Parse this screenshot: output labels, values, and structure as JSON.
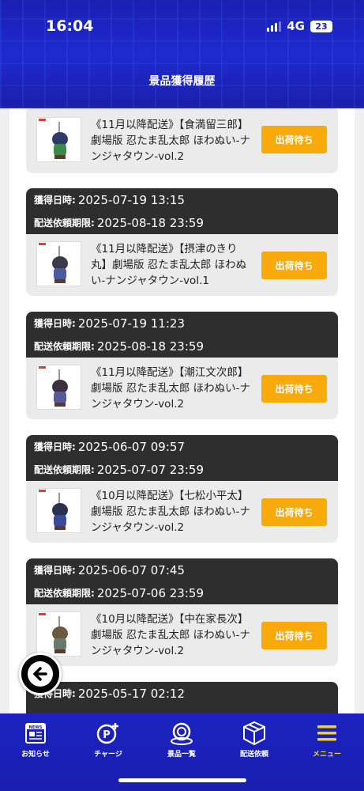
{
  "status_bar": {
    "time": "16:04",
    "network": "4G",
    "battery": "23"
  },
  "header": {
    "title": "景品獲得履歴"
  },
  "labels": {
    "acquired": "獲得日時:",
    "deadline": "配送依頼期限:"
  },
  "cards": [
    {
      "acquired": "",
      "deadline": "",
      "item": "《11月以降配送》【食満留三郎】劇場版 忍たま乱太郎 ほわぬい-ナンジャタウン-vol.2",
      "button": "出荷待ち",
      "colors": {
        "head": "#2d3a6a",
        "body": "#3a8a4a"
      }
    },
    {
      "acquired": "2025-07-19 13:15",
      "deadline": "2025-08-18 23:59",
      "item": "《11月以降配送》【摂津のきり丸】劇場版 忍たま乱太郎 ほわぬい-ナンジャタウン-vol.1",
      "button": "出荷待ち",
      "colors": {
        "head": "#3a3a4a",
        "body": "#4a5aa0"
      }
    },
    {
      "acquired": "2025-07-19 11:23",
      "deadline": "2025-08-18 23:59",
      "item": "《11月以降配送》【潮江文次郎】劇場版 忍たま乱太郎 ほわぬい-ナンジャタウン-vol.2",
      "button": "出荷待ち",
      "colors": {
        "head": "#3a3040",
        "body": "#5a5a9a"
      }
    },
    {
      "acquired": "2025-06-07 09:57",
      "deadline": "2025-07-07 23:59",
      "item": "《10月以降配送》【七松小平太】劇場版 忍たま乱太郎 ほわぬい-ナンジャタウン-vol.2",
      "button": "出荷待ち",
      "colors": {
        "head": "#2a3050",
        "body": "#3a4a9a"
      }
    },
    {
      "acquired": "2025-06-07 07:45",
      "deadline": "2025-07-06 23:59",
      "item": "《10月以降配送》【中在家長次】劇場版 忍たま乱太郎 ほわぬい-ナンジャタウン-vol.2",
      "button": "出荷待ち",
      "colors": {
        "head": "#6a5a40",
        "body": "#6a7a6a"
      }
    },
    {
      "acquired": "2025-05-17 02:12",
      "deadline": "",
      "item": "",
      "button": "",
      "colors": {
        "head": "#333333",
        "body": "#333333"
      }
    }
  ],
  "nav": [
    {
      "label": "お知らせ",
      "icon": "news-icon"
    },
    {
      "label": "チャージ",
      "icon": "charge-icon"
    },
    {
      "label": "景品一覧",
      "icon": "prize-list-icon"
    },
    {
      "label": "配送依頼",
      "icon": "delivery-box-icon"
    },
    {
      "label": "メニュー",
      "icon": "menu-icon",
      "active": true
    }
  ],
  "theme": {
    "primary": "#1a1fb0",
    "button": "#f8aa0a",
    "card_head": "#2e2e2e",
    "active_nav": "#ffd400"
  }
}
